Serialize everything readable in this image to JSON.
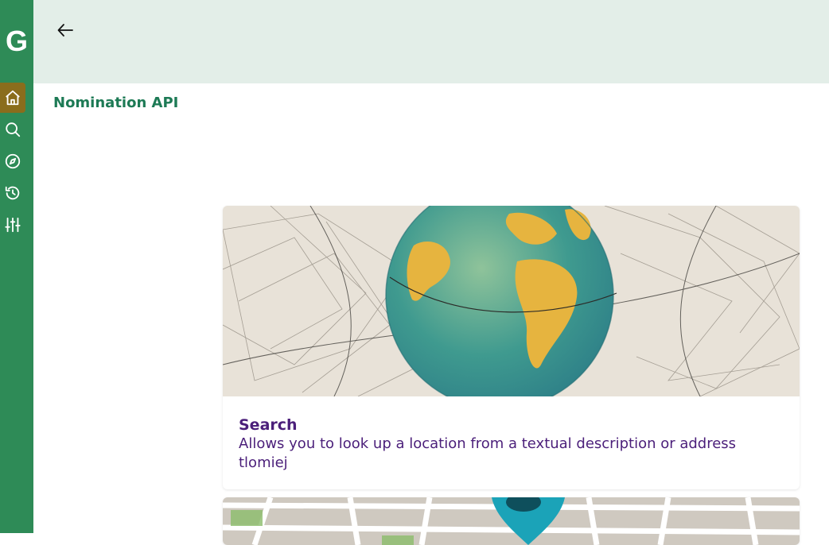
{
  "app": {
    "logo_letter": "G"
  },
  "sidebar": {
    "items": [
      {
        "icon": "home-icon",
        "active": true
      },
      {
        "icon": "search-icon",
        "active": false
      },
      {
        "icon": "compass-icon",
        "active": false
      },
      {
        "icon": "history-icon",
        "active": false
      },
      {
        "icon": "sliders-icon",
        "active": false
      }
    ]
  },
  "header": {
    "back_icon": "arrow-left-icon"
  },
  "page": {
    "title": "Nomination API"
  },
  "cards": [
    {
      "image": "globe-network-illustration",
      "title": "Search",
      "description": "Allows you to look up a location from a textual description or address",
      "author": "tlomiej"
    },
    {
      "image": "map-pin-illustration"
    }
  ],
  "colors": {
    "sidebar_bg": "#2e8b57",
    "sidebar_active": "#8a6d1c",
    "header_bg": "#e3eee8",
    "title_green": "#1d7a55",
    "card_text_purple": "#4b1f7a"
  }
}
